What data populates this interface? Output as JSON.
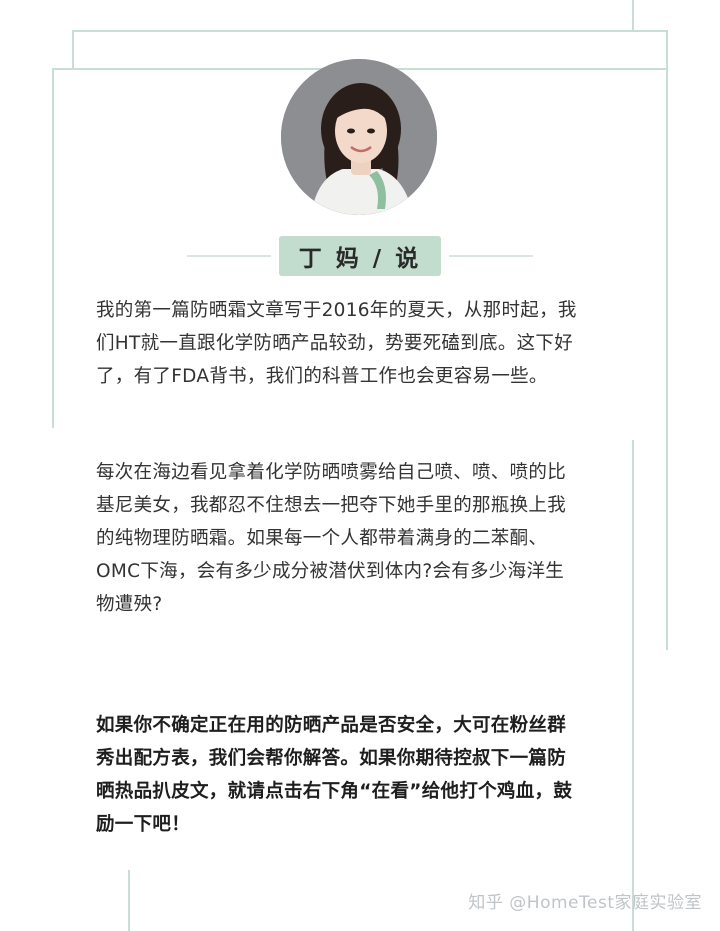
{
  "author": {
    "avatar_alt": "",
    "title": "丁 妈 / 说"
  },
  "paragraphs": [
    {
      "lines": [
        "我的第一篇防晒霜文章写于2016年的夏天，从那时起，我",
        "们HT就一直跟化学防晒产品较劲，势要死磕到底。这下好",
        "了，有了FDA背书，我们的科普工作也会更容易一些。"
      ]
    },
    {
      "lines": [
        "每次在海边看见拿着化学防晒喷雾给自己喷、喷、喷的比",
        "基尼美女，我都忍不住想去一把夺下她手里的那瓶换上我",
        "的纯物理防晒霜。如果每一个人都带着满身的二苯酮、",
        "OMC下海，会有多少成分被潜伏到体内?会有多少海洋生",
        "物遭殃?"
      ]
    },
    {
      "lines": [
        "如果你不确定正在用的防晒产品是否安全，大可在粉丝群",
        "秀出配方表，我们会帮你解答。如果你期待控叔下一篇防",
        "晒热品扒皮文，就请点击右下角“在看”给他打个鸡血，鼓",
        "励一下吧！"
      ]
    }
  ],
  "watermark": "知乎 @HomeTest家庭实验室",
  "colors": {
    "frame": "#c8ded4",
    "badge": "#c2dccd",
    "text": "#333333"
  }
}
